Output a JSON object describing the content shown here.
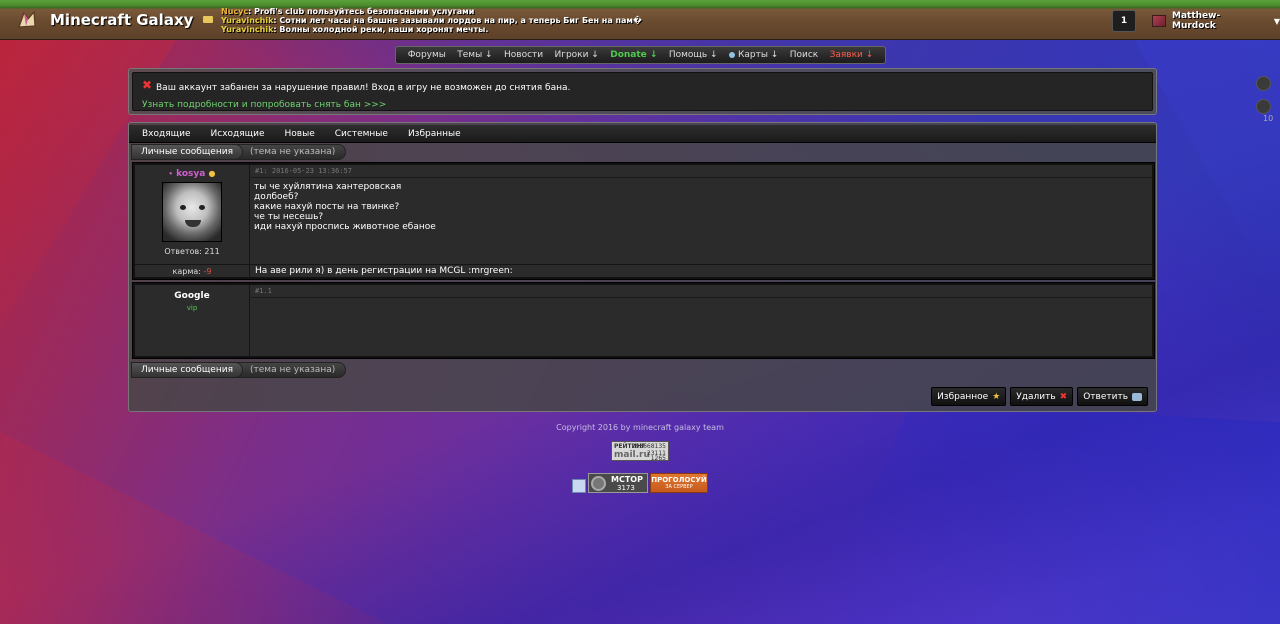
{
  "header": {
    "site_title": "Minecraft Galaxy",
    "chat": [
      {
        "user": "Nucyc",
        "text": ": Profi's club пользуйтесь безопасными услугами"
      },
      {
        "user": "Yuravinchik",
        "text": ": Сотни лет часы на башне зазывали лордов на пир, а теперь Биг Бен на пам�"
      },
      {
        "user": "Yuravinchik",
        "text": ": Волны холодной реки, наши хоронят мечты."
      }
    ],
    "notification_count": "1",
    "username": "Matthew-Murdock",
    "user_caret": "▼"
  },
  "nav": {
    "items": [
      {
        "label": "Форумы"
      },
      {
        "label": "Темы ↓"
      },
      {
        "label": "Новости"
      },
      {
        "label": "Игроки ↓"
      },
      {
        "label": "Donate ↓"
      },
      {
        "label": "Помощь ↓"
      },
      {
        "label": "Карты ↓"
      },
      {
        "label": "Поиск"
      },
      {
        "label": "Заявки ↓"
      }
    ]
  },
  "ban": {
    "icon": "✖",
    "message": "Ваш аккаунт забанен за нарушение правил! Вход в игру не возможен до снятия бана.",
    "link": "Узнать подробности и попробовать снять бан >>>"
  },
  "side": {
    "number": "10"
  },
  "pm": {
    "tabs": [
      "Входящие",
      "Исходящие",
      "Новые",
      "Системные",
      "Избранные"
    ],
    "breadcrumb": {
      "section": "Личные сообщения",
      "topic": "(тема не указана)"
    },
    "post1": {
      "author_prefix": "•",
      "author": "kosya",
      "author_star": "●",
      "meta": "#1: 2016-05-23 13:36:57",
      "lines": [
        "ты че хуйлятина хантеровская",
        "долбоеб?",
        "какие нахуй посты на твинке?",
        "че ты несешь?",
        "иди нахуй проспись животное ебаное"
      ],
      "replies_label": "Ответов: 211",
      "karma_label": "карма:",
      "karma_value": "-9",
      "signature": "На аве рили я) в день регистрации на MCGL :mrgreen:"
    },
    "post2": {
      "author": "Google",
      "role": "vip",
      "meta": "#1.1"
    },
    "buttons": {
      "favorite": "Избранное",
      "favorite_icon": "★",
      "delete": "Удалить",
      "delete_icon": "✖",
      "reply": "Ответить"
    }
  },
  "footer": {
    "copyright": "Copyright 2016 by minecraft galaxy team",
    "mail_counter": {
      "title": "РЕЙТИНГ",
      "brand": "mail.ru",
      "n1": "293668135",
      "n2": "23111",
      "n3": "1265"
    },
    "top_counter": {
      "title": "МСТОР",
      "value": "3173"
    },
    "vote": {
      "line1": "ПРОГОЛОСУЙ",
      "line2": "ЗА СЕРВЕР"
    }
  }
}
